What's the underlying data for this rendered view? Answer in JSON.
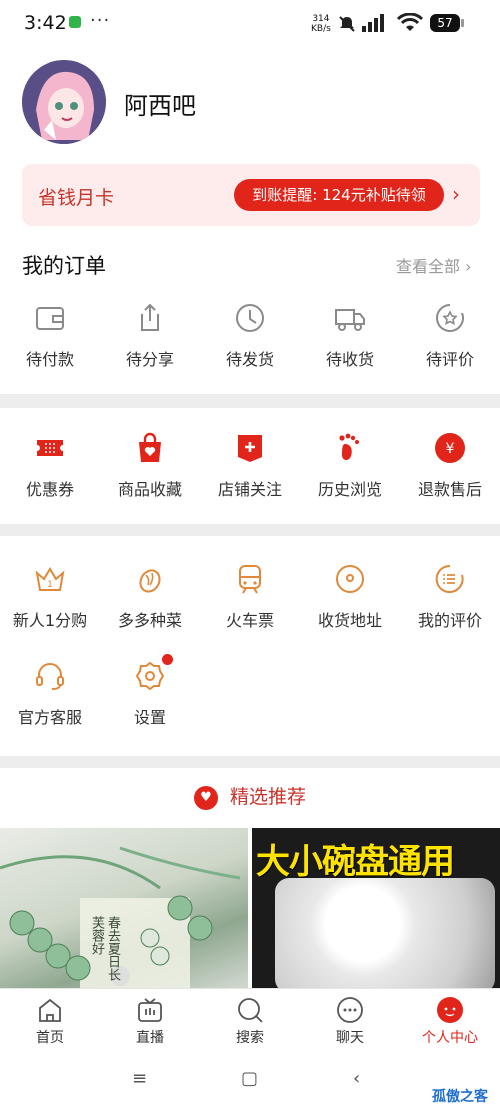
{
  "status": {
    "time": "3:42",
    "dots": "···",
    "speed_top": "314",
    "speed_bottom": "KB/s",
    "battery": "57"
  },
  "profile": {
    "username": "阿西吧"
  },
  "savings_card": {
    "title": "省钱月卡",
    "pill": "到账提醒: 124元补贴待领",
    "arrow": "›"
  },
  "orders": {
    "title": "我的订单",
    "view_all": "查看全部 ›",
    "items": [
      {
        "label": "待付款",
        "icon": "wallet-icon"
      },
      {
        "label": "待分享",
        "icon": "share-icon"
      },
      {
        "label": "待发货",
        "icon": "clock-icon"
      },
      {
        "label": "待收货",
        "icon": "truck-icon"
      },
      {
        "label": "待评价",
        "icon": "review-star-icon"
      }
    ]
  },
  "quick": {
    "items": [
      {
        "label": "优惠券",
        "icon": "coupon-icon"
      },
      {
        "label": "商品收藏",
        "icon": "favorite-bag-icon"
      },
      {
        "label": "店铺关注",
        "icon": "store-follow-icon"
      },
      {
        "label": "历史浏览",
        "icon": "footprint-icon"
      },
      {
        "label": "退款售后",
        "icon": "refund-icon"
      }
    ]
  },
  "services": {
    "items": [
      {
        "label": "新人1分购",
        "icon": "crown-icon"
      },
      {
        "label": "多多种菜",
        "icon": "vegetable-icon"
      },
      {
        "label": "火车票",
        "icon": "train-icon"
      },
      {
        "label": "收货地址",
        "icon": "location-icon"
      },
      {
        "label": "我的评价",
        "icon": "comment-icon"
      },
      {
        "label": "官方客服",
        "icon": "headset-icon"
      },
      {
        "label": "设置",
        "icon": "settings-icon"
      }
    ]
  },
  "recommend": {
    "title": "精选推荐"
  },
  "products": {
    "right_banner": "大小碗盘通用",
    "left_text": "春去夏日长 芙蓉好"
  },
  "bottom_nav": {
    "items": [
      {
        "label": "首页",
        "icon": "home-icon"
      },
      {
        "label": "直播",
        "icon": "live-tv-icon"
      },
      {
        "label": "搜索",
        "icon": "search-icon"
      },
      {
        "label": "聊天",
        "icon": "chat-icon"
      },
      {
        "label": "个人中心",
        "icon": "profile-icon",
        "active": true
      }
    ]
  },
  "system_nav": {
    "menu": "≡",
    "home": "▢",
    "back": "‹"
  },
  "watermark": "孤傲之客",
  "colors": {
    "accent": "#e1251b",
    "orange_icon": "#e0893a",
    "gray_icon": "#8a8a8a"
  }
}
